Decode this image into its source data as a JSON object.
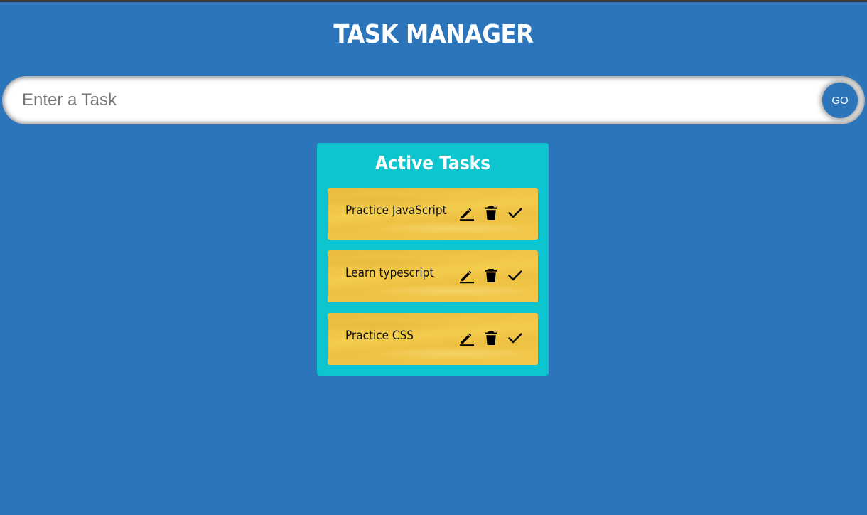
{
  "app": {
    "title": "TASK MANAGER"
  },
  "task_form": {
    "placeholder": "Enter a Task",
    "value": "",
    "submit_label": "GO"
  },
  "active_panel": {
    "title": "Active Tasks",
    "tasks": [
      {
        "text": "Practice JavaScript",
        "actions": [
          "edit-icon",
          "delete-icon",
          "check-icon"
        ]
      },
      {
        "text": "Learn typescript",
        "actions": [
          "edit-icon",
          "delete-icon",
          "check-icon"
        ]
      },
      {
        "text": "Practice CSS",
        "actions": [
          "edit-icon",
          "delete-icon",
          "check-icon"
        ]
      }
    ]
  },
  "colors": {
    "background": "#2c75bb",
    "panel": "#0dc5cf",
    "task_card": "#f0c545",
    "go_button": "#2c75bb",
    "text_on_dark": "#ffffff"
  }
}
